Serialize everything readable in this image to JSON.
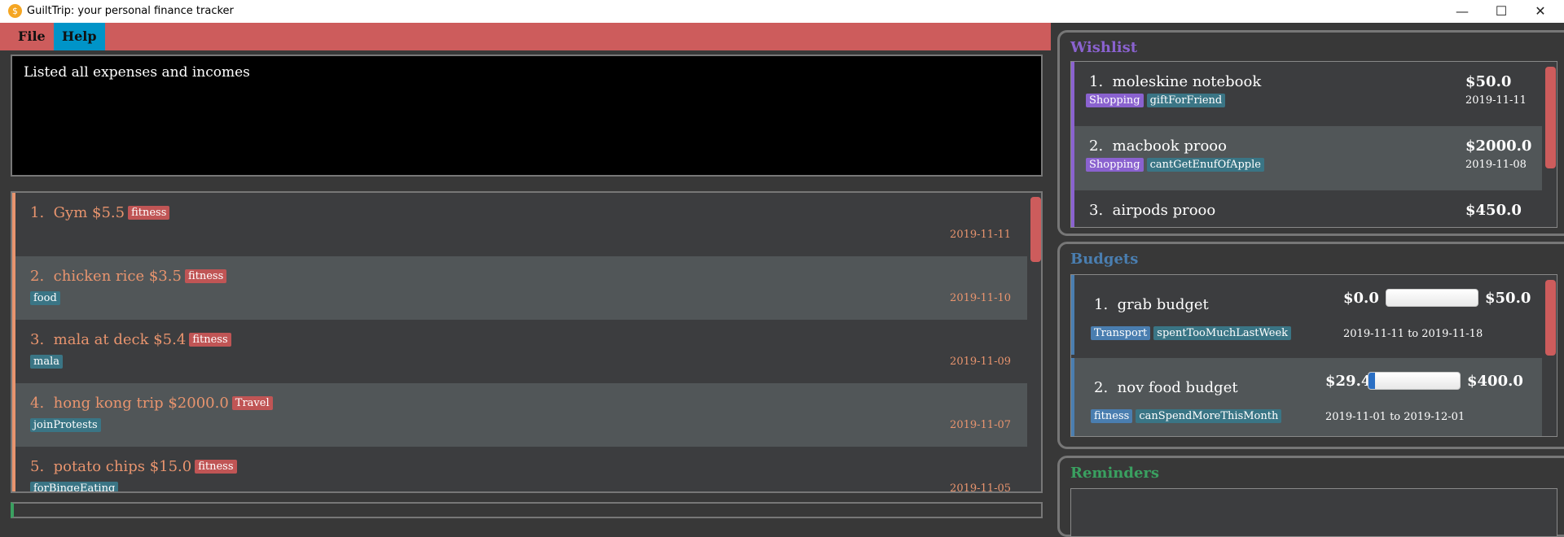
{
  "window": {
    "title": "GuiltTrip: your personal finance tracker",
    "icon": "coin-icon"
  },
  "menu": [
    "File",
    "Help"
  ],
  "result": "Listed all expenses and incomes",
  "colors": {
    "menubar": "#cd5c5c",
    "help_active": "#0094c8",
    "expense": "#e8946e",
    "wishlist": "#8a62cf",
    "budgets": "#4a7eb0",
    "reminders": "#3aa060"
  },
  "entries": [
    {
      "index": "1.",
      "desc": "Gym",
      "amount": "$5.5",
      "category": "fitness",
      "tags": [],
      "date": "2019-11-11"
    },
    {
      "index": "2.",
      "desc": "chicken rice",
      "amount": "$3.5",
      "category": "fitness",
      "tags": [
        "food"
      ],
      "date": "2019-11-10"
    },
    {
      "index": "3.",
      "desc": "mala at deck",
      "amount": "$5.4",
      "category": "fitness",
      "tags": [
        "mala"
      ],
      "date": "2019-11-09"
    },
    {
      "index": "4.",
      "desc": "hong kong trip",
      "amount": "$2000.0",
      "category": "Travel",
      "tags": [
        "joinProtests"
      ],
      "date": "2019-11-07"
    },
    {
      "index": "5.",
      "desc": "potato chips",
      "amount": "$15.0",
      "category": "fitness",
      "tags": [
        "forBingeEating"
      ],
      "date": "2019-11-05"
    }
  ],
  "wishlist": {
    "title": "Wishlist",
    "items": [
      {
        "index": "1.",
        "name": "moleskine notebook",
        "amount": "$50.0",
        "category": "Shopping",
        "tag": "giftForFriend",
        "date": "2019-11-11"
      },
      {
        "index": "2.",
        "name": "macbook prooo",
        "amount": "$2000.0",
        "category": "Shopping",
        "tag": "cantGetEnufOfApple",
        "date": "2019-11-08"
      },
      {
        "index": "3.",
        "name": "airpods prooo",
        "amount": "$450.0"
      }
    ]
  },
  "budgets": {
    "title": "Budgets",
    "items": [
      {
        "index": "1.",
        "name": "grab budget",
        "spent": "$0.0",
        "limit": "$50.0",
        "progress": 0.0,
        "category": "Transport",
        "tag": "spentTooMuchLastWeek",
        "period": "2019-11-11 to 2019-11-18"
      },
      {
        "index": "2.",
        "name": "nov food budget",
        "spent": "$29.4",
        "limit": "$400.0",
        "progress": 0.0735,
        "category": "fitness",
        "tag": "canSpendMoreThisMonth",
        "period": "2019-11-01 to 2019-12-01"
      }
    ]
  },
  "reminders": {
    "title": "Reminders"
  }
}
